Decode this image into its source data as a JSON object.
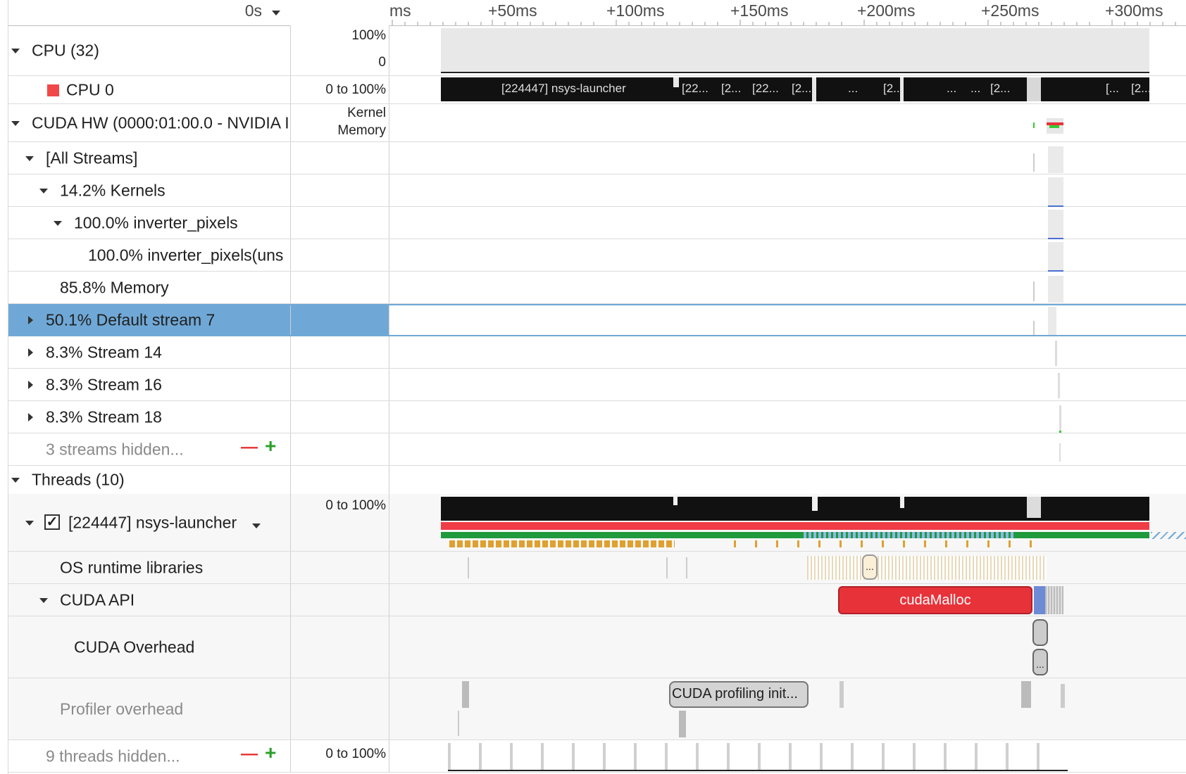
{
  "header": {
    "time_origin": "0s",
    "ticks": [
      "ms",
      "+50ms",
      "+100ms",
      "+150ms",
      "+200ms",
      "+250ms",
      "+300ms"
    ]
  },
  "rows": {
    "cpu_group": {
      "label": "CPU (32)",
      "scale_top": "100%",
      "scale_bottom": "0"
    },
    "cpu0": {
      "label": "CPU 0",
      "range": "0 to 100%",
      "color": "#f04848"
    },
    "cuda_hw": {
      "label": "CUDA HW (0000:01:00.0 - NVIDIA I",
      "legend_line1": "Kernel",
      "legend_line2": "Memory"
    },
    "all_streams": {
      "label": "[All Streams]"
    },
    "kernels": {
      "label": "14.2% Kernels"
    },
    "inverter": {
      "label": "100.0% inverter_pixels"
    },
    "inverter_uns": {
      "label": "100.0% inverter_pixels(uns"
    },
    "memory": {
      "label": "85.8% Memory"
    },
    "default_stream": {
      "label": "50.1% Default stream 7"
    },
    "stream14": {
      "label": "8.3% Stream 14"
    },
    "stream16": {
      "label": "8.3% Stream 16"
    },
    "stream18": {
      "label": "8.3% Stream 18"
    },
    "streams_hidden": {
      "label": "3 streams hidden...",
      "minus": "—",
      "plus": "+"
    },
    "threads": {
      "label": "Threads (10)"
    },
    "launcher": {
      "label": "[224447] nsys-launcher",
      "range": "0 to 100%",
      "checked": true
    },
    "os_runtime": {
      "label": "OS runtime libraries"
    },
    "cuda_api": {
      "label": "CUDA API"
    },
    "cuda_overhead": {
      "label": "CUDA Overhead"
    },
    "profiler_overhead": {
      "label": "Profiler overhead"
    },
    "threads_hidden": {
      "label": "9 threads hidden...",
      "range": "0 to 100%",
      "minus": "—",
      "plus": "+"
    }
  },
  "timeline": {
    "cpu0_labels": [
      "[224447] nsys-launcher",
      "[22...",
      "[2...",
      "[22...",
      "[2...",
      "...",
      "[2...",
      "...",
      "...",
      "[2...",
      "[...",
      "[2..."
    ],
    "cuda_malloc": "cudaMalloc",
    "os_ellipsis": "...",
    "overhead_ellipsis": "...",
    "profiling_init": "CUDA profiling init..."
  },
  "colors": {
    "selection": "#6fa8d6",
    "cuda_malloc": "#e8323a",
    "thread_red": "#f03c46",
    "thread_green": "#1f9a3c",
    "os_orange": "#e0a030"
  }
}
